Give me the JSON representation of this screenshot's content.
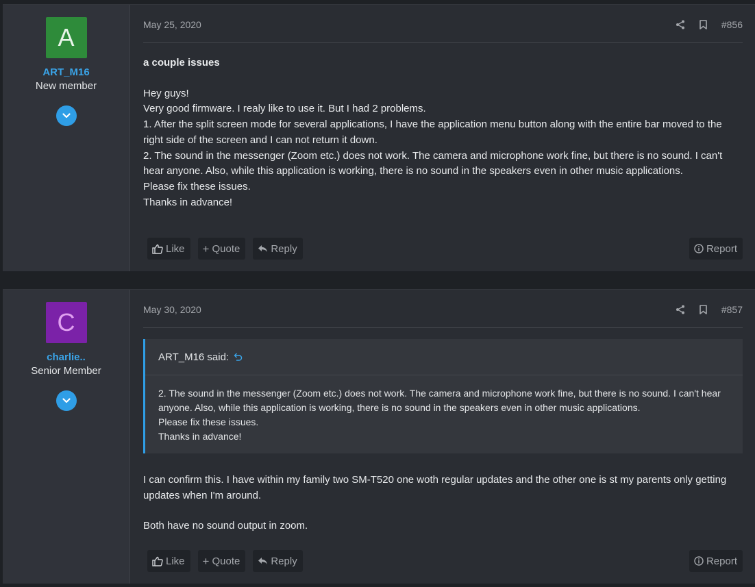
{
  "posts": [
    {
      "user": {
        "initial": "A",
        "name": "ART_M16",
        "title": "New member",
        "avatar_bg": "#2e8b3a",
        "avatar_fg": "#e8f5e9"
      },
      "date": "May 25, 2020",
      "number": "#856",
      "thread_title": "a couple issues",
      "lines": [
        "Hey guys!",
        "Very good firmware. I realy like to use it. But I had 2 problems.",
        "1. After the split screen mode for several applications, I have the application menu button along with the entire bar moved to the right side of the screen and I can not return it down.",
        "2. The sound in the messenger (Zoom etc.) does not work. The camera and microphone work fine, but there is no sound. I can't hear anyone. Also, while this application is working, there is no sound in the speakers even in other music applications.",
        "Please fix these issues.",
        "Thanks in advance!"
      ]
    },
    {
      "user": {
        "initial": "C",
        "name": "charlie..",
        "title": "Senior Member",
        "avatar_bg": "#7b22a8",
        "avatar_fg": "#e0a0f0"
      },
      "date": "May 30, 2020",
      "number": "#857",
      "quote": {
        "author_said": "ART_M16 said:",
        "lines": [
          "2. The sound in the messenger (Zoom etc.) does not work. The camera and microphone work fine, but there is no sound. I can't hear anyone. Also, while this application is working, there is no sound in the speakers even in other music applications.",
          "Please fix these issues.",
          "Thanks in advance!"
        ]
      },
      "paragraphs": [
        "I can confirm this. I have within my family two SM-T520 one woth regular updates and the other one is st my parents only getting updates when I'm around.",
        "Both have no sound output in zoom."
      ]
    }
  ],
  "actions": {
    "like": "Like",
    "quote": "Quote",
    "reply": "Reply",
    "report": "Report"
  },
  "icons": {
    "share": "share-icon",
    "bookmark": "bookmark-icon",
    "expand": "chevron-down-icon",
    "like": "thumbs-up-icon",
    "quote": "plus-icon",
    "reply": "reply-icon",
    "report": "info-circle-icon",
    "quote_link": "return-arrow-icon"
  }
}
